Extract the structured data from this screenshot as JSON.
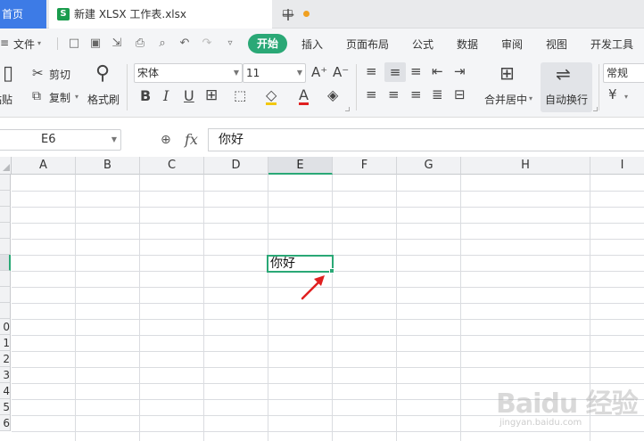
{
  "tabbar": {
    "home_label": "首页",
    "file_icon_letter": "S",
    "file_tab_label": "新建 XLSX 工作表.xlsx",
    "new_tab_symbol": "+"
  },
  "menubar": {
    "file_label": "文件",
    "tabs": [
      "开始",
      "插入",
      "页面布局",
      "公式",
      "数据",
      "审阅",
      "视图",
      "开发工具"
    ]
  },
  "ribbon": {
    "paste_label": "粘贴",
    "cut_label": "剪切",
    "copy_label": "复制",
    "format_painter_label": "格式刷",
    "font_name": "宋体",
    "font_size": "11",
    "merge_center_label": "合并居中",
    "wrap_text_label": "自动换行",
    "number_format": "常规",
    "bold": "B",
    "italic": "I",
    "underline": "U",
    "font_color_letter": "A",
    "grow_font": "A⁺",
    "shrink_font": "A⁻",
    "currency_symbol": "¥"
  },
  "formula_bar": {
    "name_box": "E6",
    "fx_label": "fx",
    "formula_value": "你好"
  },
  "sheet": {
    "columns": [
      "A",
      "B",
      "C",
      "D",
      "E",
      "F",
      "G",
      "H",
      "I"
    ],
    "active_column": "E",
    "visible_row_labels": [
      "0",
      "1",
      "2",
      "3",
      "4",
      "5",
      "6"
    ],
    "active_cell_value": "你好"
  },
  "watermark": {
    "main": "Baidu 经验",
    "sub": "jingyan.baidu.com"
  },
  "colors": {
    "accent_green": "#2aa876",
    "home_tab_blue": "#3d7be6",
    "annotation_arrow": "#e02020"
  }
}
